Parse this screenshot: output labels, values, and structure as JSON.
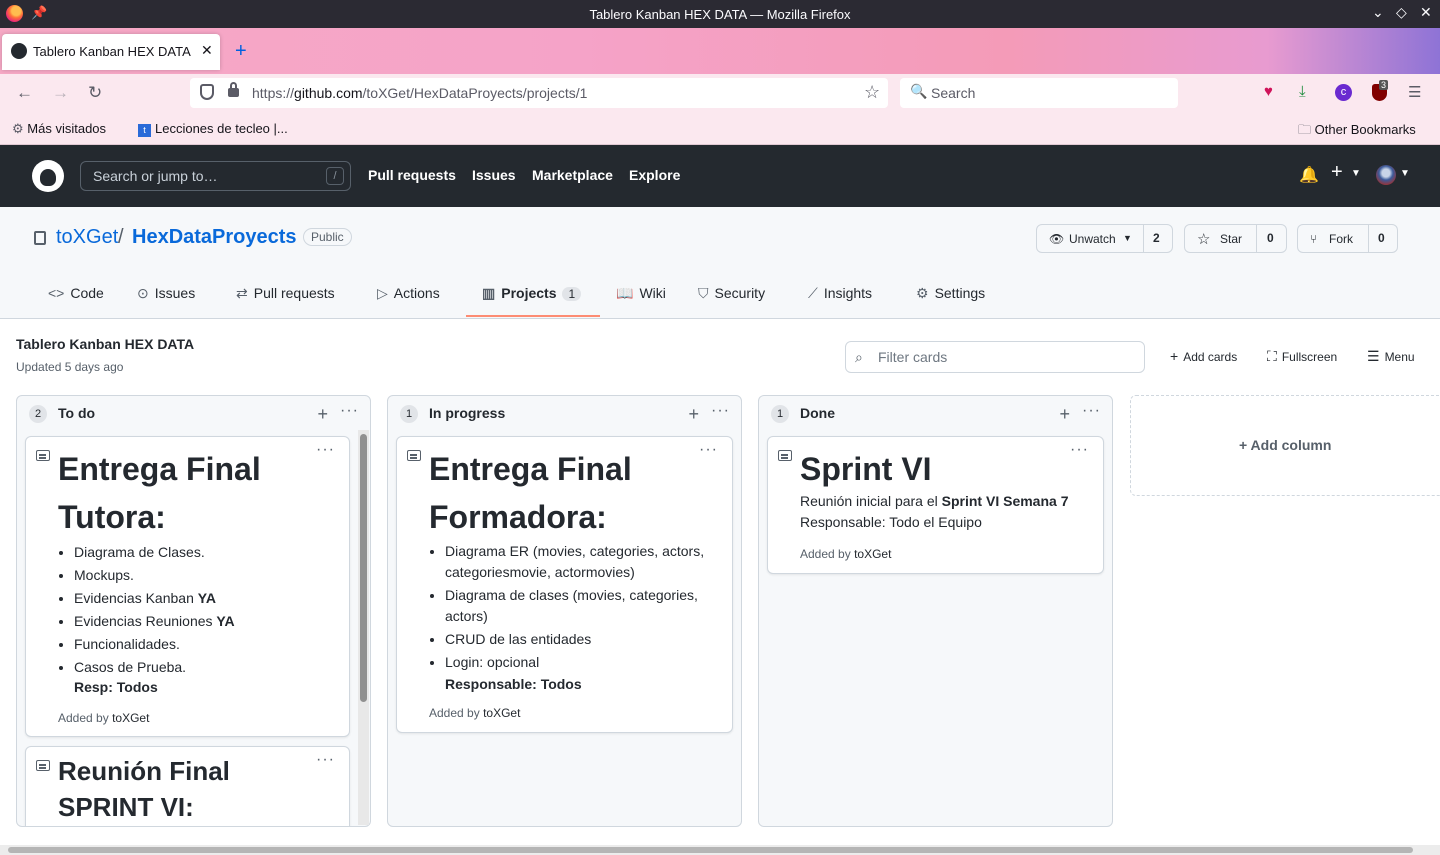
{
  "window": {
    "title": "Tablero Kanban HEX DATA — Mozilla Firefox"
  },
  "browser": {
    "tab_label": "Tablero Kanban HEX DATA",
    "url_scheme": "https://",
    "url_host": "github.com",
    "url_path": "/toXGet/HexDataProyects/projects/1",
    "search_placeholder": "Search",
    "bookmarks": [
      "Más visitados",
      "Lecciones de tecleo |...",
      "Other Bookmarks"
    ],
    "extension_badge": "3"
  },
  "github": {
    "search_placeholder": "Search or jump to…",
    "search_shortcut": "/",
    "nav": [
      "Pull requests",
      "Issues",
      "Marketplace",
      "Explore"
    ]
  },
  "repo": {
    "owner": "toXGet",
    "name": "HexDataProyects",
    "visibility": "Public",
    "unwatch_label": "Unwatch",
    "watch_count": "2",
    "star_label": "Star",
    "star_count": "0",
    "fork_label": "Fork",
    "fork_count": "0",
    "tabs": [
      {
        "label": "Code",
        "icon": "code-icon"
      },
      {
        "label": "Issues",
        "icon": "issue-icon"
      },
      {
        "label": "Pull requests",
        "icon": "pull-request-icon"
      },
      {
        "label": "Actions",
        "icon": "play-icon"
      },
      {
        "label": "Projects",
        "icon": "project-icon",
        "counter": "1",
        "selected": true
      },
      {
        "label": "Wiki",
        "icon": "book-icon"
      },
      {
        "label": "Security",
        "icon": "shield-icon"
      },
      {
        "label": "Insights",
        "icon": "graph-icon"
      },
      {
        "label": "Settings",
        "icon": "gear-icon"
      }
    ]
  },
  "project": {
    "title": "Tablero Kanban HEX DATA",
    "updated": "Updated 5 days ago",
    "filter_placeholder": "Filter cards",
    "add_cards_label": "Add cards",
    "fullscreen_label": "Fullscreen",
    "menu_label": "Menu",
    "add_column_label": "Add column",
    "columns": [
      {
        "name": "To do",
        "count": "2",
        "cards": [
          {
            "title": "Entrega Final Tutora:",
            "items": [
              "Diagrama de Clases.",
              "Mockups.",
              "Evidencias Kanban",
              "Evidencias Reuniones",
              "Funcionalidades.",
              "Casos de Prueba."
            ],
            "item_suffix": "YA",
            "note": "Resp: Todos",
            "added_prefix": "Added by",
            "added_by": "toXGet"
          },
          {
            "title": "Reunión Final SPRINT VI:"
          }
        ]
      },
      {
        "name": "In progress",
        "count": "1",
        "cards": [
          {
            "title": "Entrega Final Formadora:",
            "items": [
              "Diagrama ER (movies, categories, actors, categoriesmovie, actormovies)",
              "Diagrama de clases (movies, categories, actors)",
              "CRUD de las entidades",
              "Login: opcional"
            ],
            "note": "Responsable: Todos",
            "added_prefix": "Added by",
            "added_by": "toXGet"
          }
        ]
      },
      {
        "name": "Done",
        "count": "1",
        "cards": [
          {
            "title": "Sprint VI",
            "line1_prefix": "Reunión inicial para el",
            "line1_bold": "Sprint VI Semana 7",
            "line2": "Responsable: Todo el Equipo",
            "added_prefix": "Added by",
            "added_by": "toXGet"
          }
        ]
      }
    ]
  }
}
